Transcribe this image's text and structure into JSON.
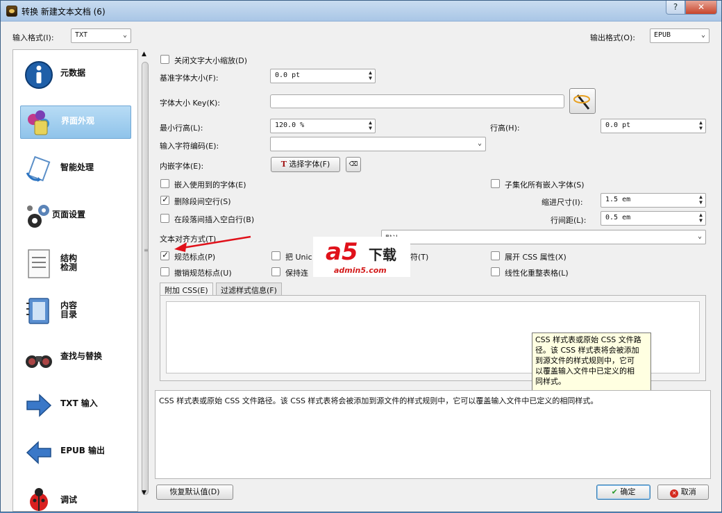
{
  "window": {
    "title": "转换 新建文本文档 (6)",
    "help_label": "?",
    "close_label": "✕"
  },
  "format": {
    "input_label": "输入格式(I):",
    "input_value": "TXT",
    "output_label": "输出格式(O):",
    "output_value": "EPUB"
  },
  "sidebar": {
    "items": [
      {
        "label": "元数据",
        "icon": "info-icon"
      },
      {
        "label": "界面外观",
        "icon": "palette-icon",
        "active": true
      },
      {
        "label": "智能处理",
        "icon": "heuristics-icon"
      },
      {
        "label": "页面设置",
        "icon": "gears-icon"
      },
      {
        "label": "结构\n检测",
        "icon": "document-icon"
      },
      {
        "label": "内容\n目录",
        "icon": "notebook-icon"
      },
      {
        "label": "查找与替换",
        "icon": "binoculars-icon"
      },
      {
        "label": "TXT 输入",
        "icon": "arrow-right-icon"
      },
      {
        "label": "EPUB 输出",
        "icon": "arrow-left-icon"
      },
      {
        "label": "调试",
        "icon": "ladybug-icon"
      }
    ]
  },
  "look": {
    "disable_font_rescale": "关闭文字大小缩放(D)",
    "base_font_label": "基准字体大小(F):",
    "base_font_value": "0.0 pt",
    "font_key_label": "字体大小 Key(K):",
    "font_key_value": "",
    "min_line_height_label": "最小行高(L):",
    "min_line_height_value": "120.0 %",
    "line_height_label": "行高(H):",
    "line_height_value": "0.0 pt",
    "input_encoding_label": "输入字符编码(E):",
    "input_encoding_value": "",
    "embed_font_label": "内嵌字体(E):",
    "choose_font_button": "选择字体(F)",
    "embed_used_fonts": "嵌入使用到的字体(E)",
    "subset_fonts": "子集化所有嵌入字体(S)",
    "remove_blank_para": "删除段间空行(S)",
    "indent_label": "缩进尺寸(I):",
    "indent_value": "1.5 em",
    "insert_blank_line": "在段落间插入空白行(B)",
    "spacing_label": "行间距(L):",
    "spacing_value": "0.5 em",
    "text_align_label": "文本对齐方式(T)",
    "text_align_value": "默认",
    "smarten_punct": "规范标点(P)",
    "unicode_prefix": "把 Unic",
    "unicode_suffix": "符(T)",
    "expand_css": "展开 CSS 属性(X)",
    "unsmarten_punct": "撤销规范标点(U)",
    "keep_ligatures": "保持连",
    "linearize_tables": "线性化重整表格(L)"
  },
  "checks": {
    "disable_font_rescale": false,
    "embed_used_fonts": false,
    "subset_fonts": false,
    "remove_blank_para": true,
    "insert_blank_line": false,
    "smarten_punct": true,
    "unicode": false,
    "expand_css": false,
    "unsmarten_punct": false,
    "keep_ligatures": false,
    "linearize_tables": false
  },
  "tabs": [
    {
      "label": "附加 CSS(E)",
      "active": true
    },
    {
      "label": "过滤样式信息(F)",
      "active": false
    }
  ],
  "tooltip": "CSS 样式表或原始 CSS 文件路径。该 CSS 样式表将会被添加到源文件的样式规则中，它可以覆盖输入文件中已定义的相同样式。",
  "tooltip_lines": [
    "CSS 样式表或原始 CSS 文件路",
    "径。该 CSS 样式表将会被添加",
    "到源文件的样式规则中，它可",
    "以覆盖输入文件中已定义的相",
    "同样式。"
  ],
  "description": "CSS 样式表或原始 CSS 文件路径。该 CSS 样式表将会被添加到源文件的样式规则中，它可以覆盖输入文件中已定义的相同样式。",
  "buttons": {
    "restore_defaults": "恢复默认值(D)",
    "ok": "确定",
    "cancel": "取消"
  },
  "watermark": {
    "brand": "a5",
    "download": "下载",
    "url": "admin5.com"
  },
  "colors": {
    "accent": "#8fc3ea",
    "arrow_red": "#e0111a"
  }
}
